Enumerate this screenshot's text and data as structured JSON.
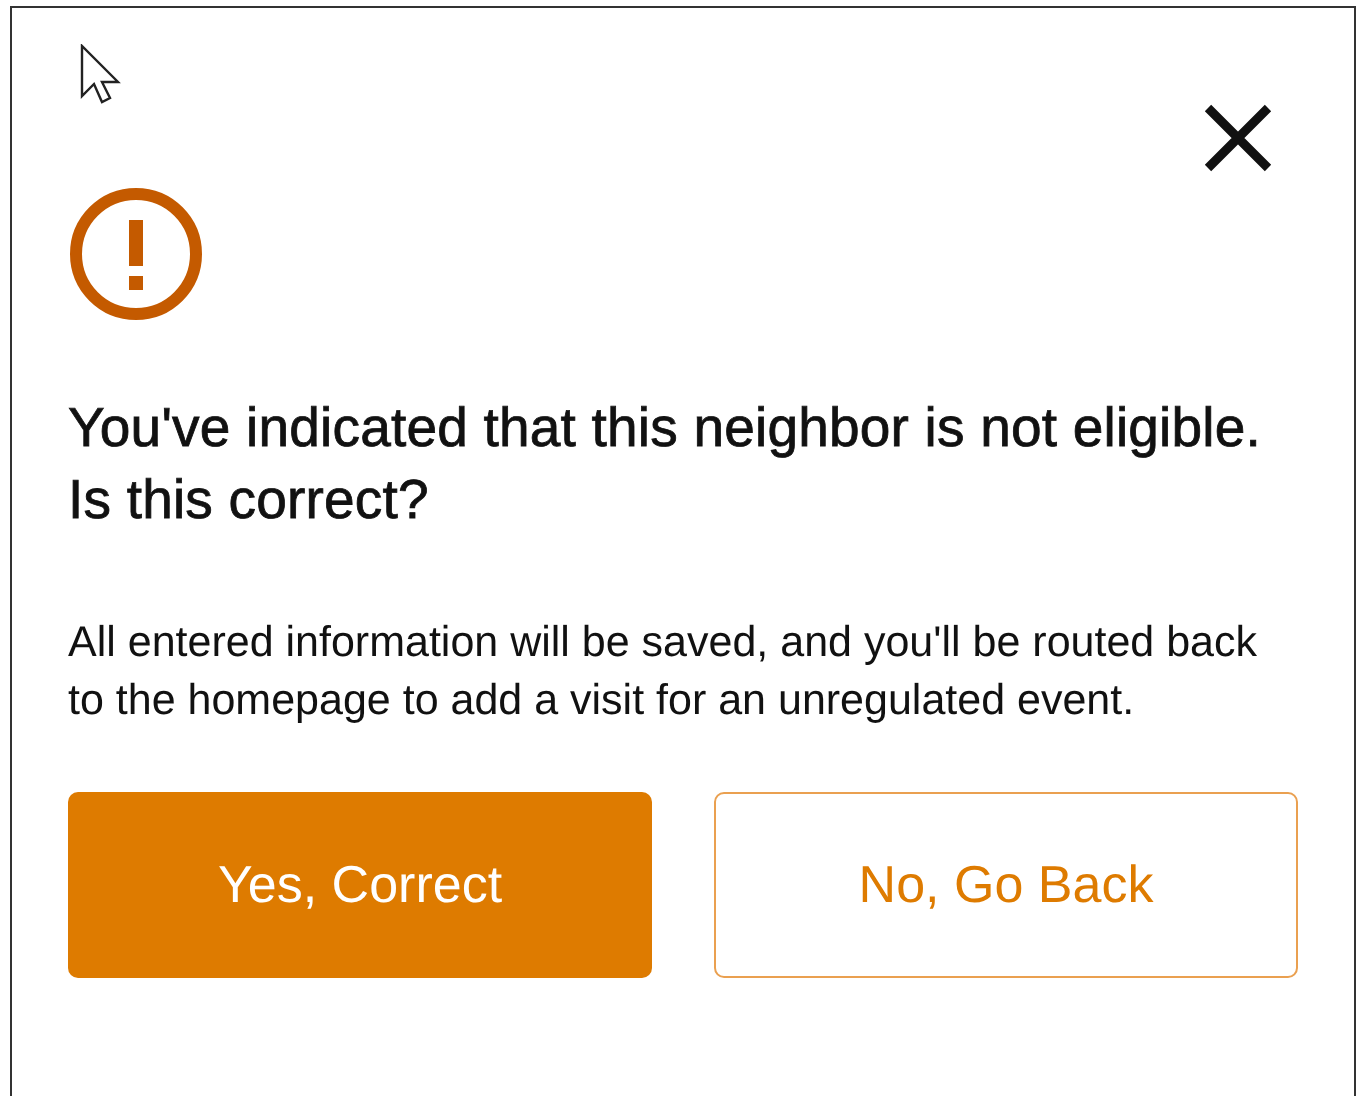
{
  "dialog": {
    "heading": "You've indicated that this neighbor is not eligible. Is this correct?",
    "message": "All entered information will be saved, and you'll be routed back to the homepage to add a visit for an unregulated event.",
    "buttons": [
      {
        "label": "Yes, Correct",
        "kind": "primary"
      },
      {
        "label": "No, Go Back",
        "kind": "secondary"
      }
    ]
  }
}
